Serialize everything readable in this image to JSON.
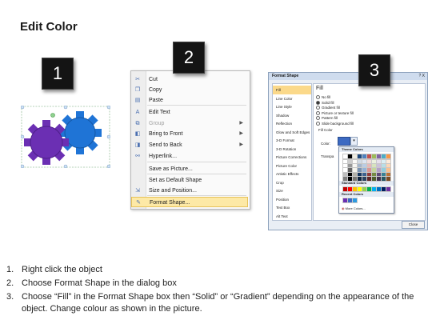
{
  "title": "Edit Color",
  "steps": [
    "1",
    "2",
    "3"
  ],
  "context_menu": {
    "items": [
      {
        "label": "Cut",
        "icon": "scissors-icon",
        "glyph": "✂",
        "disabled": false,
        "submenu": false,
        "highlighted": false
      },
      {
        "label": "Copy",
        "icon": "copy-icon",
        "glyph": "❐",
        "disabled": false,
        "submenu": false,
        "highlighted": false
      },
      {
        "label": "Paste",
        "icon": "paste-icon",
        "glyph": "▤",
        "disabled": false,
        "submenu": false,
        "highlighted": false
      },
      {
        "label": "Edit Text",
        "icon": "edit-text-icon",
        "glyph": "A",
        "disabled": false,
        "submenu": false,
        "highlighted": false
      },
      {
        "label": "Group",
        "icon": "group-icon",
        "glyph": "⧉",
        "disabled": true,
        "submenu": true,
        "highlighted": false
      },
      {
        "label": "Bring to Front",
        "icon": "bring-front-icon",
        "glyph": "◧",
        "disabled": false,
        "submenu": true,
        "highlighted": false
      },
      {
        "label": "Send to Back",
        "icon": "send-back-icon",
        "glyph": "◨",
        "disabled": false,
        "submenu": true,
        "highlighted": false
      },
      {
        "label": "Hyperlink...",
        "icon": "hyperlink-icon",
        "glyph": "⚯",
        "disabled": false,
        "submenu": false,
        "highlighted": false
      },
      {
        "label": "Save as Picture...",
        "icon": "",
        "glyph": "",
        "disabled": false,
        "submenu": false,
        "highlighted": false
      },
      {
        "label": "Set as Default Shape",
        "icon": "",
        "glyph": "",
        "disabled": false,
        "submenu": false,
        "highlighted": false
      },
      {
        "label": "Size and Position...",
        "icon": "size-position-icon",
        "glyph": "⇲",
        "disabled": false,
        "submenu": false,
        "highlighted": false
      },
      {
        "label": "Format Shape...",
        "icon": "format-shape-icon",
        "glyph": "✎",
        "disabled": false,
        "submenu": false,
        "highlighted": true
      }
    ]
  },
  "format_dialog": {
    "title": "Format Shape",
    "controls": "? X",
    "nav": [
      "Fill",
      "Line Color",
      "Line Style",
      "Shadow",
      "Reflection",
      "Glow and Soft Edges",
      "3-D Format",
      "3-D Rotation",
      "Picture Corrections",
      "Picture Color",
      "Artistic Effects",
      "Crop",
      "Size",
      "Position",
      "Text Box",
      "Alt Text"
    ],
    "fill_heading": "Fill",
    "options": [
      {
        "label": "No fill",
        "on": false
      },
      {
        "label": "Solid fill",
        "on": true
      },
      {
        "label": "Gradient fill",
        "on": false
      },
      {
        "label": "Picture or texture fill",
        "on": false
      },
      {
        "label": "Pattern fill",
        "on": false
      },
      {
        "label": "Slide background fill",
        "on": false
      }
    ],
    "fill_color_heading": "Fill Color",
    "color_label": "Color:",
    "transparency_label": "Transpa",
    "palette": {
      "theme_heading": "Theme Colors",
      "standard_heading": "Standard Colors",
      "recent_heading": "Recent Colors",
      "more_colors": "More Colors...",
      "theme_top": [
        "#ffffff",
        "#000000",
        "#eeece1",
        "#1f497d",
        "#4f81bd",
        "#c0504d",
        "#9bbb59",
        "#8064a2",
        "#4bacc6",
        "#f79646"
      ],
      "standard": [
        "#c00000",
        "#ff0000",
        "#ffc000",
        "#ffff00",
        "#92d050",
        "#00b050",
        "#00b0f0",
        "#0070c0",
        "#002060",
        "#7030a0"
      ],
      "recent": [
        "#6b2fb3",
        "#3c6ac2",
        "#2e9be0"
      ]
    },
    "close_label": "Close"
  },
  "instructions": [
    {
      "num": "1.",
      "text": "Right click the object"
    },
    {
      "num": "2.",
      "text": "Choose Format Shape in the dialog box"
    },
    {
      "num": "3.",
      "text": "Choose “Fill” in the Format Shape box then “Solid” or “Gradient” depending on the appearance of the object. Change colour as shown in the picture."
    }
  ],
  "colors": {
    "gear_purple": "#6b2fb3",
    "gear_blue": "#1f74d6",
    "highlight": "#fde9a6"
  }
}
